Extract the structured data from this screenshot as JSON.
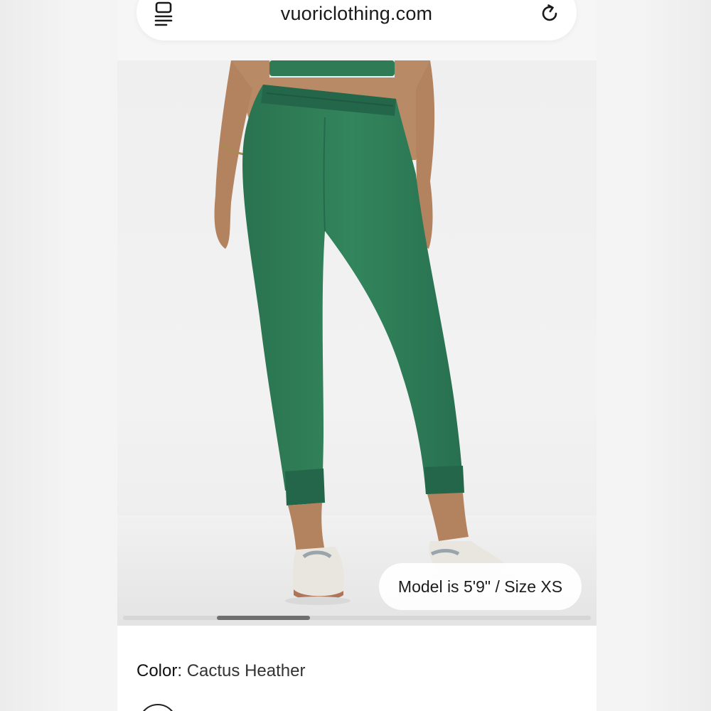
{
  "browser": {
    "url": "vuoriclothing.com",
    "tabs_icon": "tabs-icon",
    "reload_icon": "reload-icon"
  },
  "product": {
    "image_badge": "Model is 5'9\" / Size XS",
    "carousel": {
      "count": 5,
      "active_index": 1
    },
    "color_label": "Color",
    "color_separator": ": ",
    "color_value": "Cactus Heather",
    "colors": {
      "pants": "#2f7d57",
      "pants_shadow": "#24664a",
      "skin": "#b98a66",
      "shoe": "#e9e6df"
    }
  }
}
